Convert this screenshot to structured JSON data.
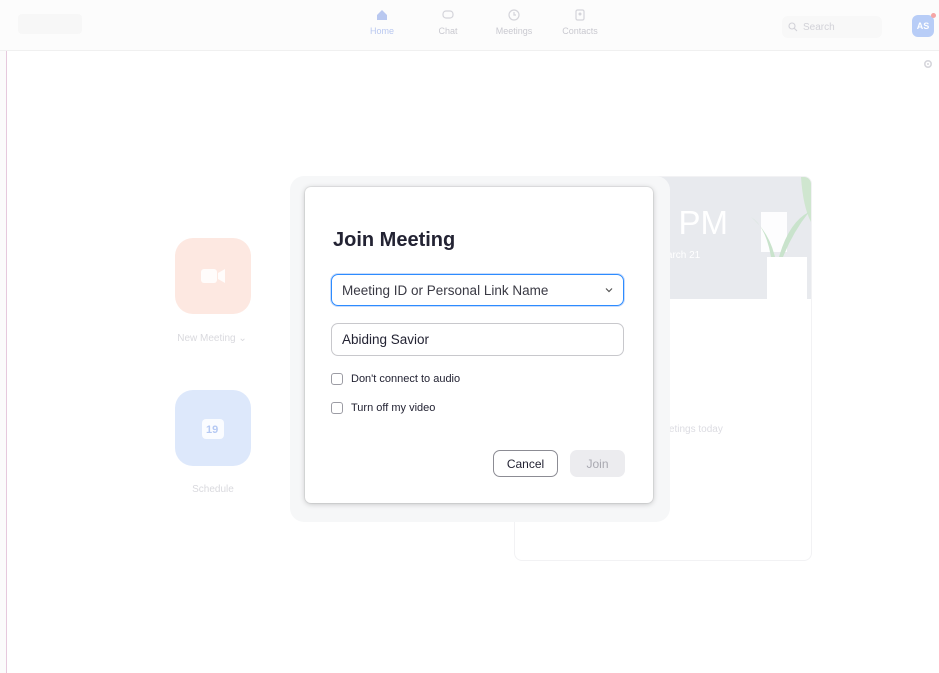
{
  "nav": {
    "items": [
      {
        "label": "Home",
        "icon": "home-icon",
        "active": true
      },
      {
        "label": "Chat",
        "icon": "chat-icon",
        "active": false
      },
      {
        "label": "Meetings",
        "icon": "clock-icon",
        "active": false
      },
      {
        "label": "Contacts",
        "icon": "contacts-icon",
        "active": false
      }
    ]
  },
  "search": {
    "placeholder": "Search"
  },
  "user": {
    "initials": "AS"
  },
  "background": {
    "new_meeting_label": "New Meeting ⌄",
    "schedule_label": "Schedule",
    "schedule_day": "19",
    "time": "4 PM",
    "date": ", March 21",
    "no_meetings": "meetings today"
  },
  "dialog": {
    "title": "Join Meeting",
    "meeting_id_placeholder": "Meeting ID or Personal Link Name",
    "name_value": "Abiding Savior",
    "audio_option": "Don't connect to audio",
    "video_option": "Turn off my video",
    "audio_checked": false,
    "video_checked": false,
    "cancel_label": "Cancel",
    "join_label": "Join"
  },
  "colors": {
    "accent": "#2d8cff",
    "new_meeting": "#ff742e",
    "schedule": "#2d8cff"
  }
}
